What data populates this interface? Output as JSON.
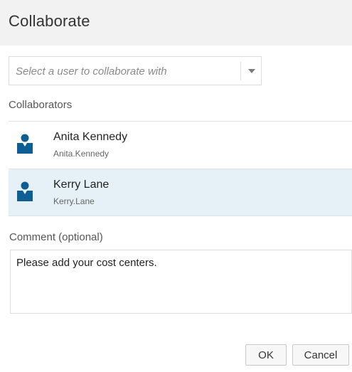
{
  "dialog": {
    "title": "Collaborate"
  },
  "user_select": {
    "placeholder": "Select a user to collaborate with",
    "icon": "chevron-down-icon"
  },
  "collaborators": {
    "label": "Collaborators",
    "items": [
      {
        "name": "Anita Kennedy",
        "username": "Anita.Kennedy",
        "selected": false,
        "icon": "user-avatar-icon"
      },
      {
        "name": "Kerry Lane",
        "username": "Kerry.Lane",
        "selected": true,
        "icon": "user-avatar-icon"
      }
    ]
  },
  "comment": {
    "label": "Comment (optional)",
    "value": "Please add your cost centers."
  },
  "buttons": {
    "ok_label": "OK",
    "cancel_label": "Cancel"
  },
  "colors": {
    "header_bg": "#f2f2f2",
    "selected_row_bg": "#e5f1f7",
    "avatar_blue": "#0c5e93"
  }
}
